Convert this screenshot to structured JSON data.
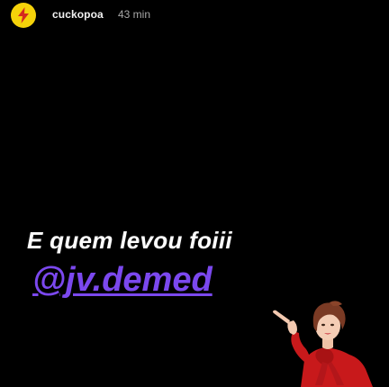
{
  "story": {
    "author": {
      "username": "cuckopoa",
      "avatar_icon": "lightning-bolt-icon",
      "avatar_color": "#f5d20a"
    },
    "time_ago": "43 min",
    "caption": {
      "line1": "E quem levou foiii",
      "mention": "@jv.demed",
      "mention_color": "#7b48ee"
    },
    "sticker": {
      "icon": "pointing-woman-sticker"
    }
  }
}
